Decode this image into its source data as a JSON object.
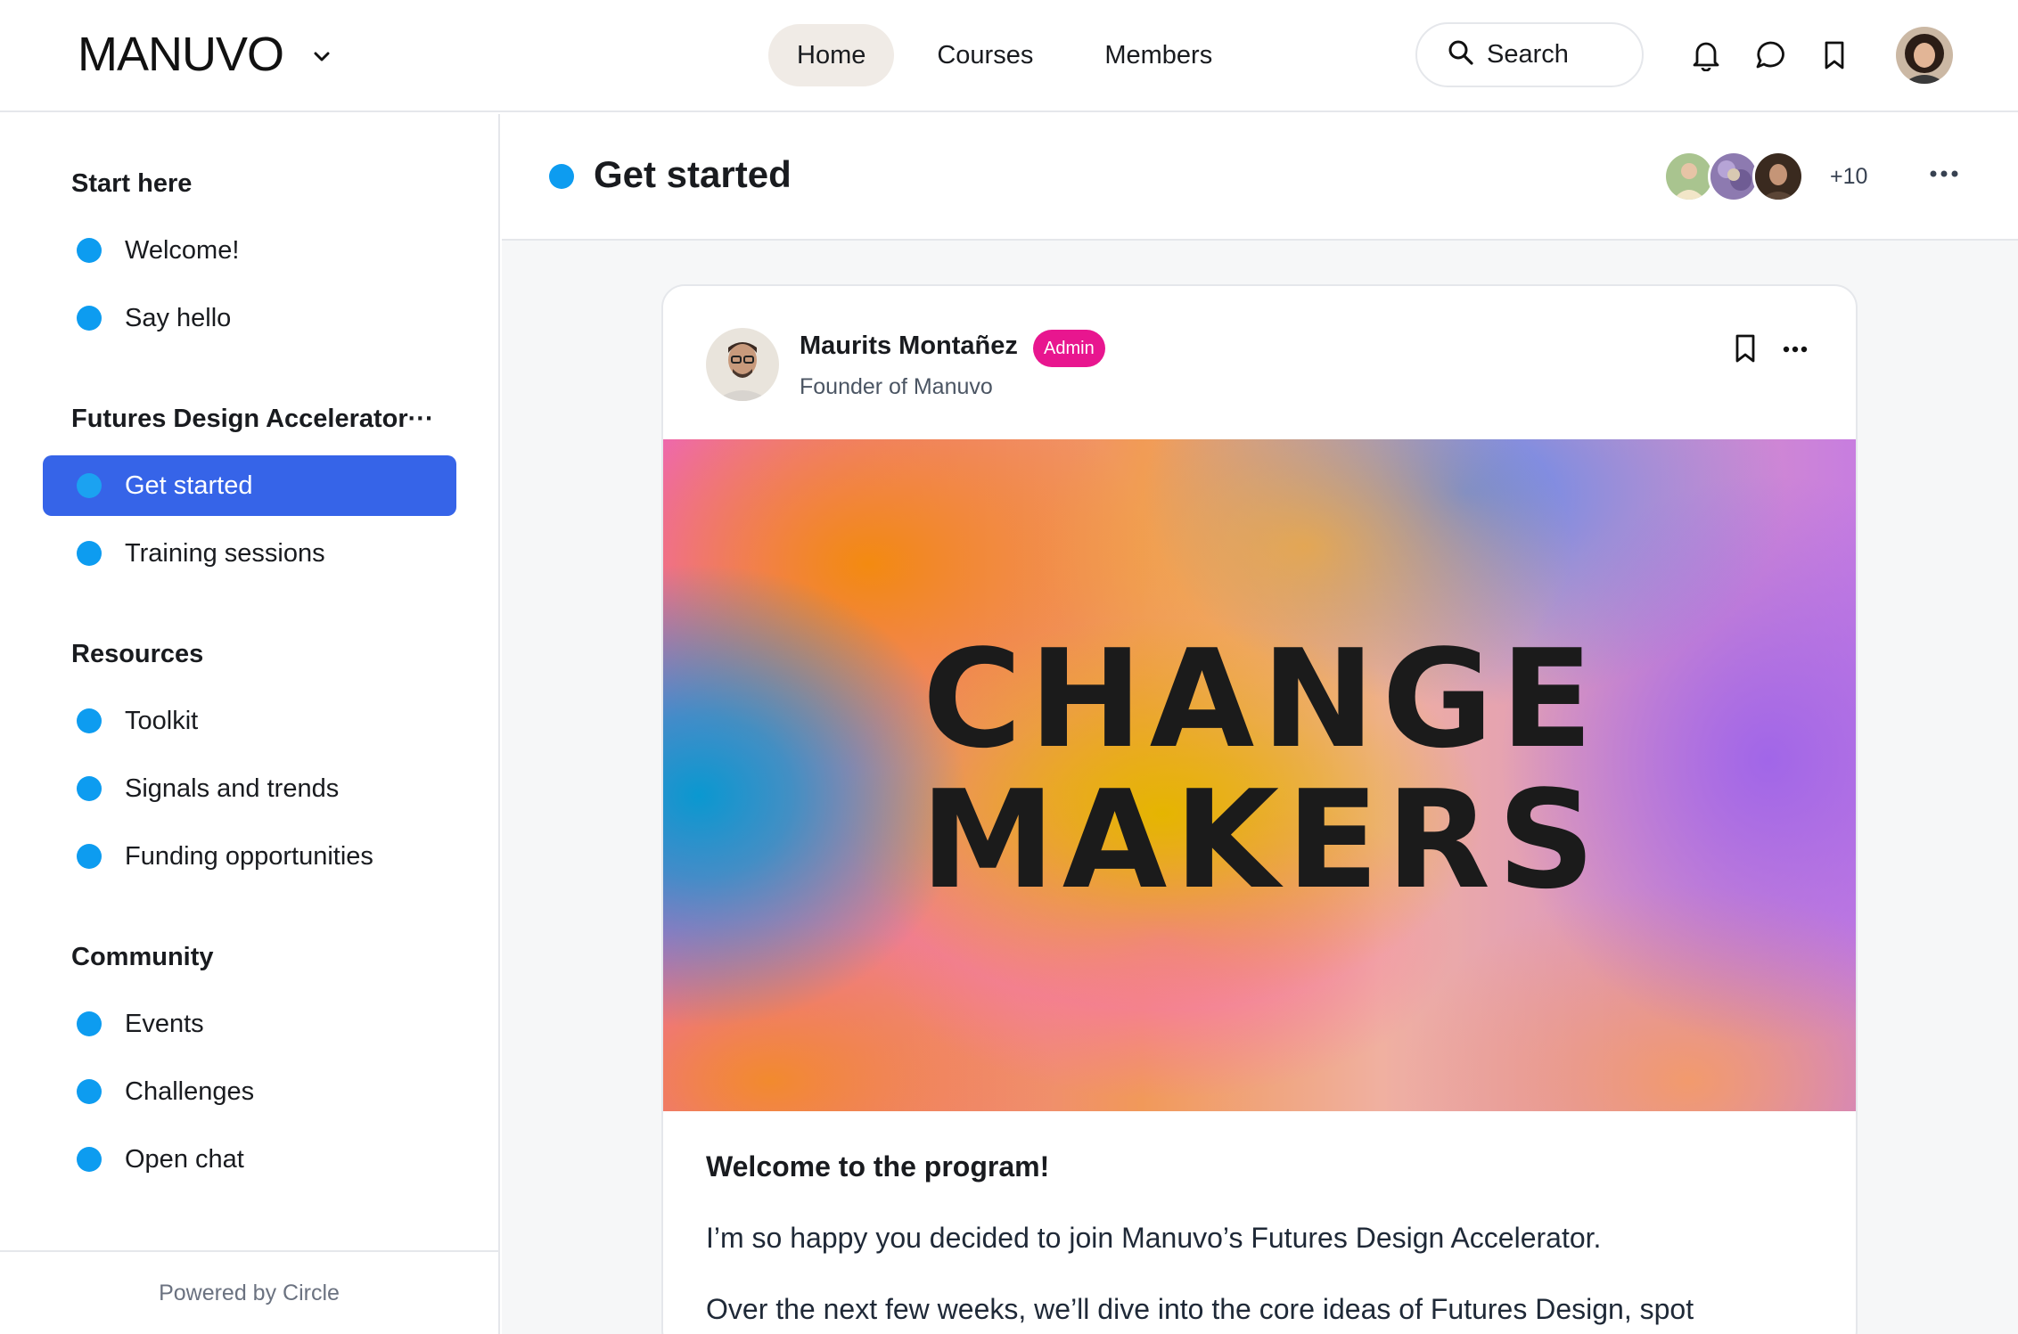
{
  "header": {
    "brand": "MANUVO",
    "nav": [
      {
        "label": "Home",
        "active": true
      },
      {
        "label": "Courses",
        "active": false
      },
      {
        "label": "Members",
        "active": false
      }
    ],
    "search_label": "Search",
    "icons": [
      "bell-icon",
      "chat-bubble-icon",
      "bookmark-icon"
    ]
  },
  "sidebar": {
    "sections": [
      {
        "title": "Start here",
        "items": [
          "Welcome!",
          "Say hello"
        ]
      },
      {
        "title": "Futures Design Accelerator···",
        "items": [
          "Get started",
          "Training sessions"
        ]
      },
      {
        "title": "Resources",
        "items": [
          "Toolkit",
          "Signals and trends",
          "Funding opportunities"
        ]
      },
      {
        "title": "Community",
        "items": [
          "Events",
          "Challenges",
          "Open chat"
        ]
      }
    ],
    "active_item": "Get started",
    "footer": "Powered by Circle"
  },
  "space": {
    "title": "Get started",
    "member_more": "+10"
  },
  "post": {
    "author_name": "Maurits Montañez",
    "author_badge": "Admin",
    "author_role": "Founder of Manuvo",
    "cover_line1": "CHANGE",
    "cover_line2": "MAKERS",
    "heading": "Welcome to the program!",
    "paragraphs": [
      "I’m so happy you decided to join Manuvo’s Futures Design Accelerator.",
      "Over the next few weeks, we’ll dive into the core ideas of Futures Design, spot"
    ]
  },
  "colors": {
    "accent": "#3664e8",
    "dot": "#0d9cf0",
    "admin_badge": "#e8168f",
    "nav_active_bg": "#f0ebe6"
  }
}
